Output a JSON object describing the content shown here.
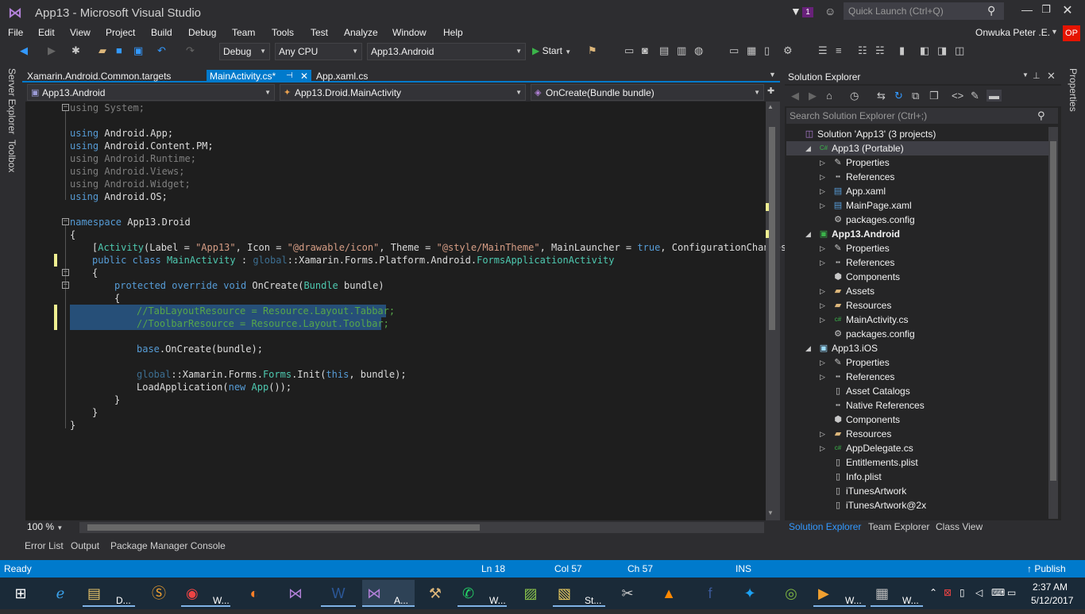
{
  "window": {
    "title": "App13 - Microsoft Visual Studio",
    "notification_count": "1",
    "quick_launch_placeholder": "Quick Launch (Ctrl+Q)",
    "user_name": "Onwuka Peter .E.",
    "user_initials": "OP"
  },
  "menu": [
    "File",
    "Edit",
    "View",
    "Project",
    "Build",
    "Debug",
    "Team",
    "Tools",
    "Test",
    "Analyze",
    "Window",
    "Help"
  ],
  "toolbar": {
    "config": "Debug",
    "platform": "Any CPU",
    "startup_project": "App13.Android",
    "start_label": "Start"
  },
  "left_strip": [
    "Server Explorer",
    "Toolbox"
  ],
  "right_strip": [
    "Properties"
  ],
  "doc_tabs": [
    {
      "label": "Xamarin.Android.Common.targets"
    },
    {
      "label": "MainActivity.cs*",
      "active": true
    },
    {
      "label": "App.xaml.cs"
    }
  ],
  "nav": {
    "project": "App13.Android",
    "class": "App13.Droid.MainActivity",
    "member": "OnCreate(Bundle bundle)"
  },
  "code": {
    "l1": "using System;",
    "l3a": "using",
    "l3b": " Android.App;",
    "l4a": "using",
    "l4b": " Android.Content.PM;",
    "l5": "using Android.Runtime;",
    "l6": "using Android.Views;",
    "l7": "using Android.Widget;",
    "l8a": "using",
    "l8b": " Android.OS;",
    "l10a": "namespace",
    "l10b": " App13.Droid",
    "l11": "{",
    "l12a": "[",
    "l12b": "Activity",
    "l12c": "(Label = ",
    "l12d": "\"App13\"",
    "l12e": ", Icon = ",
    "l12f": "\"@drawable/icon\"",
    "l12g": ", Theme = ",
    "l12h": "\"@style/MainTheme\"",
    "l12i": ", MainLauncher = ",
    "l12j": "true",
    "l12k": ", ConfigurationChanges",
    "l13a": "public",
    "l13b": " class ",
    "l13c": "MainActivity",
    "l13d": " : ",
    "l13e": "global",
    "l13f": "::Xamarin.Forms.Platform.Android.",
    "l13g": "FormsApplicationActivity",
    "l14": "{",
    "l15a": "protected",
    "l15b": " override ",
    "l15c": "void",
    "l15d": " OnCreate(",
    "l15e": "Bundle",
    "l15f": " bundle)",
    "l16": "{",
    "l17": "//TabLayoutResource = Resource.Layout.Tabbar;",
    "l18": "//ToolbarResource = Resource.Layout.Toolbar;",
    "l20a": "base",
    "l20b": ".OnCreate(bundle);",
    "l22a": "global",
    "l22b": "::Xamarin.Forms.",
    "l22c": "Forms",
    "l22d": ".Init(",
    "l22e": "this",
    "l22f": ", bundle);",
    "l23a": "LoadApplication(",
    "l23b": "new",
    "l23c": " App",
    "l23d": "());",
    "l24": "}",
    "l25": "}",
    "l26": "}"
  },
  "editor_bottom": {
    "zoom": "100 %"
  },
  "bottom_tabs": [
    "Error List",
    "Output",
    "Package Manager Console"
  ],
  "solution_explorer": {
    "title": "Solution Explorer",
    "search_placeholder": "Search Solution Explorer (Ctrl+;)",
    "items": [
      {
        "label": "Solution 'App13' (3 projects)",
        "icon": "solution-icon"
      },
      {
        "label": "App13 (Portable)",
        "icon": "csharp-project-icon"
      },
      {
        "label": "Properties",
        "icon": "wrench-icon"
      },
      {
        "label": "References",
        "icon": "references-icon"
      },
      {
        "label": "App.xaml",
        "icon": "xaml-icon"
      },
      {
        "label": "MainPage.xaml",
        "icon": "xaml-icon"
      },
      {
        "label": "packages.config",
        "icon": "config-icon"
      },
      {
        "label": "App13.Android",
        "icon": "android-project-icon"
      },
      {
        "label": "Properties",
        "icon": "wrench-icon"
      },
      {
        "label": "References",
        "icon": "references-icon"
      },
      {
        "label": "Components",
        "icon": "components-icon"
      },
      {
        "label": "Assets",
        "icon": "folder-icon"
      },
      {
        "label": "Resources",
        "icon": "folder-icon"
      },
      {
        "label": "MainActivity.cs",
        "icon": "csharp-file-icon"
      },
      {
        "label": "packages.config",
        "icon": "config-icon"
      },
      {
        "label": "App13.iOS",
        "icon": "ios-project-icon"
      },
      {
        "label": "Properties",
        "icon": "wrench-icon"
      },
      {
        "label": "References",
        "icon": "references-icon"
      },
      {
        "label": "Asset Catalogs",
        "icon": "file-icon"
      },
      {
        "label": "Native References",
        "icon": "references-icon"
      },
      {
        "label": "Components",
        "icon": "components-icon"
      },
      {
        "label": "Resources",
        "icon": "folder-icon"
      },
      {
        "label": "AppDelegate.cs",
        "icon": "csharp-file-icon"
      },
      {
        "label": "Entitlements.plist",
        "icon": "plist-icon"
      },
      {
        "label": "Info.plist",
        "icon": "plist-icon"
      },
      {
        "label": "iTunesArtwork",
        "icon": "file-icon"
      },
      {
        "label": "iTunesArtwork@2x",
        "icon": "file-icon"
      }
    ],
    "bottom_tabs": [
      "Solution Explorer",
      "Team Explorer",
      "Class View"
    ]
  },
  "status": {
    "ready": "Ready",
    "ln": "Ln 18",
    "col": "Col 57",
    "ch": "Ch 57",
    "mode": "INS",
    "publish": "Publish"
  },
  "taskbar": {
    "labels": [
      "D...",
      "W...",
      "A...",
      "W...",
      "St...",
      "W...",
      "W..."
    ],
    "time": "2:37 AM",
    "date": "5/12/2017"
  }
}
